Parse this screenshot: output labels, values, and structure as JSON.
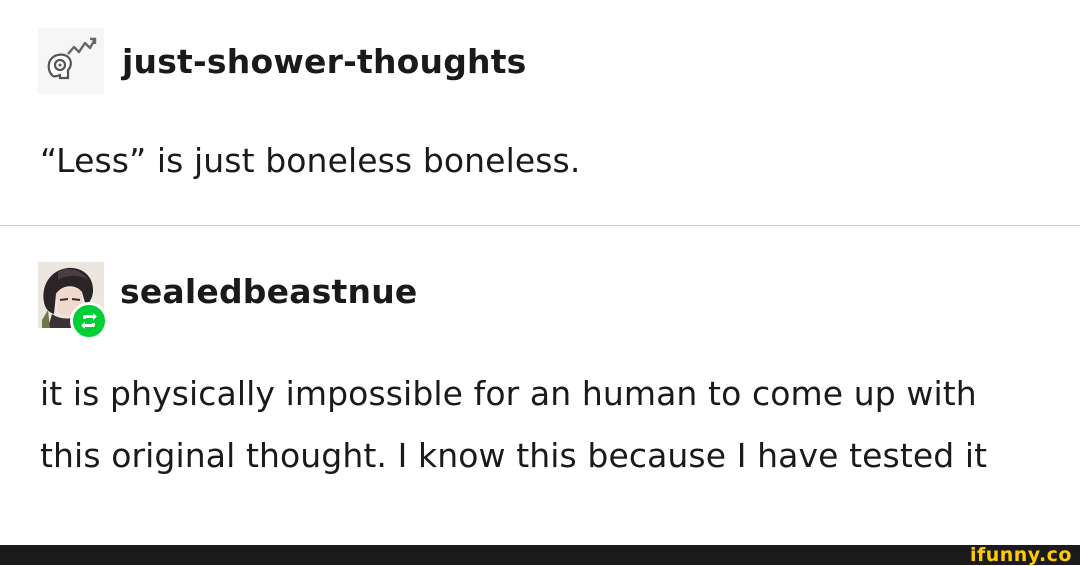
{
  "posts": [
    {
      "username": "just-shower-thoughts",
      "avatar_icon": "head-gears-icon",
      "body": "“Less” is just boneless boneless."
    },
    {
      "username": "sealedbeastnue",
      "avatar_icon": "user-avatar",
      "badge_icon": "reblog-icon",
      "badge_color": "#00cf35",
      "body": "it is physically impossible for an human to come up with this original thought. I know this because I have tested it"
    }
  ],
  "footer": {
    "watermark": "ifunny.co",
    "watermark_color": "#ffcc00",
    "bar_color": "#1b1b1b"
  }
}
